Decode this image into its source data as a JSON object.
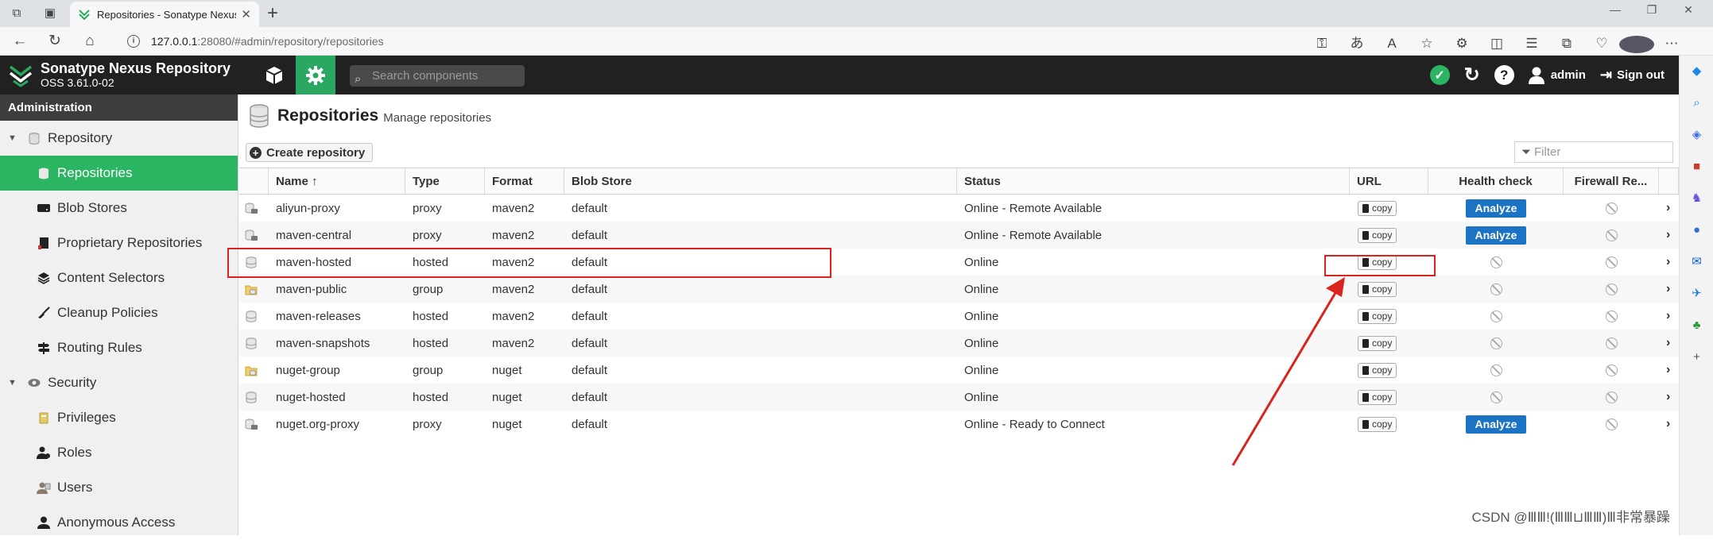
{
  "browser": {
    "tab_title": "Repositories - Sonatype Nexus R",
    "url_host": "127.0.0.1",
    "url_path": ":28080/#admin/repository/repositories"
  },
  "header": {
    "brand_title": "Sonatype Nexus Repository",
    "brand_version": "OSS 3.61.0-02",
    "search_placeholder": "Search components",
    "user": "admin",
    "signout": "Sign out"
  },
  "nav": {
    "heading": "Administration",
    "repository_section": "Repository",
    "items": [
      {
        "label": "Repositories",
        "selected": true
      },
      {
        "label": "Blob Stores"
      },
      {
        "label": "Proprietary Repositories"
      },
      {
        "label": "Content Selectors"
      },
      {
        "label": "Cleanup Policies"
      },
      {
        "label": "Routing Rules"
      }
    ],
    "security_section": "Security",
    "security_items": [
      {
        "label": "Privileges"
      },
      {
        "label": "Roles"
      },
      {
        "label": "Users"
      },
      {
        "label": "Anonymous Access"
      }
    ]
  },
  "page": {
    "title": "Repositories",
    "subtitle": "Manage repositories",
    "create_button": "Create repository",
    "filter_placeholder": "Filter"
  },
  "grid": {
    "columns": [
      "Name ↑",
      "Type",
      "Format",
      "Blob Store",
      "Status",
      "URL",
      "Health check",
      "Firewall Re..."
    ],
    "copy_label": "copy",
    "analyze_label": "Analyze",
    "rows": [
      {
        "name": "aliyun-proxy",
        "type": "proxy",
        "format": "maven2",
        "blob": "default",
        "status": "Online - Remote Available",
        "health": "analyze",
        "icon": "proxy"
      },
      {
        "name": "maven-central",
        "type": "proxy",
        "format": "maven2",
        "blob": "default",
        "status": "Online - Remote Available",
        "health": "analyze",
        "icon": "proxy"
      },
      {
        "name": "maven-hosted",
        "type": "hosted",
        "format": "maven2",
        "blob": "default",
        "status": "Online",
        "health": "none",
        "icon": "hosted"
      },
      {
        "name": "maven-public",
        "type": "group",
        "format": "maven2",
        "blob": "default",
        "status": "Online",
        "health": "none",
        "icon": "group"
      },
      {
        "name": "maven-releases",
        "type": "hosted",
        "format": "maven2",
        "blob": "default",
        "status": "Online",
        "health": "none",
        "icon": "hosted"
      },
      {
        "name": "maven-snapshots",
        "type": "hosted",
        "format": "maven2",
        "blob": "default",
        "status": "Online",
        "health": "none",
        "icon": "hosted"
      },
      {
        "name": "nuget-group",
        "type": "group",
        "format": "nuget",
        "blob": "default",
        "status": "Online",
        "health": "none",
        "icon": "group"
      },
      {
        "name": "nuget-hosted",
        "type": "hosted",
        "format": "nuget",
        "blob": "default",
        "status": "Online",
        "health": "none",
        "icon": "hosted"
      },
      {
        "name": "nuget.org-proxy",
        "type": "proxy",
        "format": "nuget",
        "blob": "default",
        "status": "Online - Ready to Connect",
        "health": "analyze",
        "icon": "proxy"
      }
    ]
  },
  "watermark": "CSDN @ⅢⅢ!(ⅢⅢ⊔ⅢⅢ)Ⅲ非常暴躁",
  "colors": {
    "accent_green": "#2bb563",
    "analyze_blue": "#1c73c4",
    "annotation_red": "#d9231f",
    "header_dark": "#212121"
  }
}
